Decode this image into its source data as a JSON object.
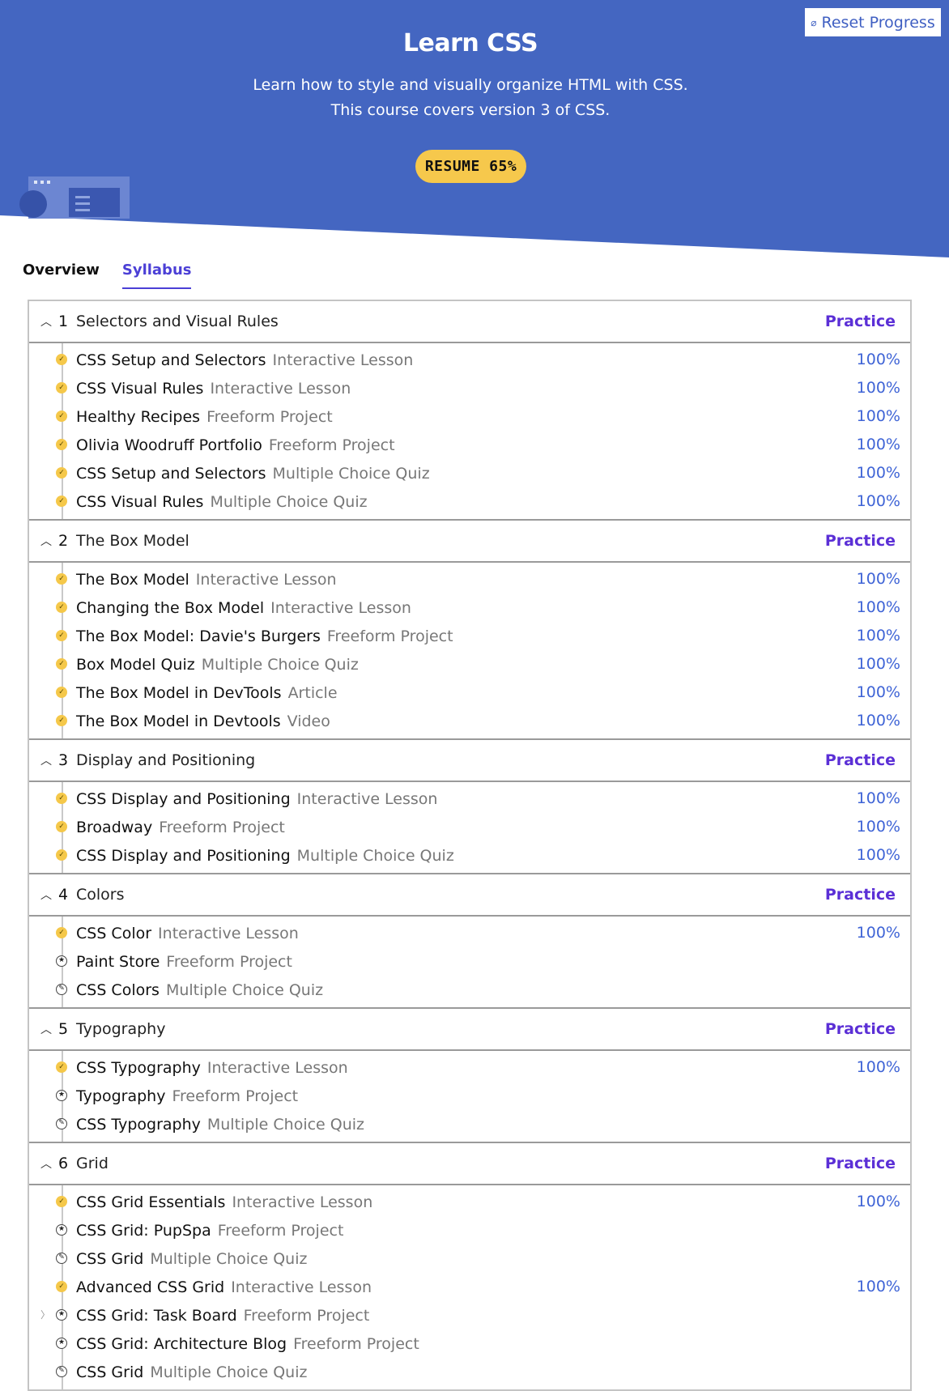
{
  "header": {
    "reset_label": "Reset Progress",
    "reset_icon": "reset-icon",
    "title": "Learn CSS",
    "description": "Learn how to style and visually organize HTML with CSS. This course covers version 3 of CSS.",
    "resume_label": "RESUME 65%",
    "resume_progress_percent": 65
  },
  "colors": {
    "hero_bg": "#4466c1",
    "accent_yellow": "#f6c84c",
    "practice": "#5b2fd6",
    "percent": "#3f64d6",
    "tab_active": "#4b3fd6"
  },
  "tabs": [
    {
      "label": "Overview",
      "active": false
    },
    {
      "label": "Syllabus",
      "active": true
    }
  ],
  "sections": [
    {
      "num": "1",
      "title": "Selectors and Visual Rules",
      "practice": "Practice",
      "items": [
        {
          "name": "CSS Setup and Selectors",
          "type": "Interactive Lesson",
          "percent": "100%",
          "status": "done"
        },
        {
          "name": "CSS Visual Rules",
          "type": "Interactive Lesson",
          "percent": "100%",
          "status": "done"
        },
        {
          "name": "Healthy Recipes",
          "type": "Freeform Project",
          "percent": "100%",
          "status": "done"
        },
        {
          "name": "Olivia Woodruff Portfolio",
          "type": "Freeform Project",
          "percent": "100%",
          "status": "done"
        },
        {
          "name": "CSS Setup and Selectors",
          "type": "Multiple Choice Quiz",
          "percent": "100%",
          "status": "done"
        },
        {
          "name": "CSS Visual Rules",
          "type": "Multiple Choice Quiz",
          "percent": "100%",
          "status": "done"
        }
      ]
    },
    {
      "num": "2",
      "title": "The Box Model",
      "practice": "Practice",
      "items": [
        {
          "name": "The Box Model",
          "type": "Interactive Lesson",
          "percent": "100%",
          "status": "done"
        },
        {
          "name": "Changing the Box Model",
          "type": "Interactive Lesson",
          "percent": "100%",
          "status": "done"
        },
        {
          "name": "The Box Model: Davie's Burgers",
          "type": "Freeform Project",
          "percent": "100%",
          "status": "done"
        },
        {
          "name": "Box Model Quiz",
          "type": "Multiple Choice Quiz",
          "percent": "100%",
          "status": "done"
        },
        {
          "name": "The Box Model in DevTools",
          "type": "Article",
          "percent": "100%",
          "status": "done"
        },
        {
          "name": "The Box Model in Devtools",
          "type": "Video",
          "percent": "100%",
          "status": "done"
        }
      ]
    },
    {
      "num": "3",
      "title": "Display and Positioning",
      "practice": "Practice",
      "items": [
        {
          "name": "CSS Display and Positioning",
          "type": "Interactive Lesson",
          "percent": "100%",
          "status": "done"
        },
        {
          "name": "Broadway",
          "type": "Freeform Project",
          "percent": "100%",
          "status": "done"
        },
        {
          "name": "CSS Display and Positioning",
          "type": "Multiple Choice Quiz",
          "percent": "100%",
          "status": "done"
        }
      ]
    },
    {
      "num": "4",
      "title": "Colors",
      "practice": "Practice",
      "items": [
        {
          "name": "CSS Color",
          "type": "Interactive Lesson",
          "percent": "100%",
          "status": "done"
        },
        {
          "name": "Paint Store",
          "type": "Freeform Project",
          "percent": "",
          "status": "project"
        },
        {
          "name": "CSS Colors",
          "type": "Multiple Choice Quiz",
          "percent": "",
          "status": "quiz"
        }
      ]
    },
    {
      "num": "5",
      "title": "Typography",
      "practice": "Practice",
      "items": [
        {
          "name": "CSS Typography",
          "type": "Interactive Lesson",
          "percent": "100%",
          "status": "done"
        },
        {
          "name": "Typography",
          "type": "Freeform Project",
          "percent": "",
          "status": "project"
        },
        {
          "name": "CSS Typography",
          "type": "Multiple Choice Quiz",
          "percent": "",
          "status": "quiz"
        }
      ]
    },
    {
      "num": "6",
      "title": "Grid",
      "practice": "Practice",
      "items": [
        {
          "name": "CSS Grid Essentials",
          "type": "Interactive Lesson",
          "percent": "100%",
          "status": "done"
        },
        {
          "name": "CSS Grid: PupSpa",
          "type": "Freeform Project",
          "percent": "",
          "status": "project"
        },
        {
          "name": "CSS Grid",
          "type": "Multiple Choice Quiz",
          "percent": "",
          "status": "quiz"
        },
        {
          "name": "Advanced CSS Grid",
          "type": "Interactive Lesson",
          "percent": "100%",
          "status": "done"
        },
        {
          "name": "CSS Grid: Task Board",
          "type": "Freeform Project",
          "percent": "",
          "status": "project",
          "hover_caret": true
        },
        {
          "name": "CSS Grid: Architecture Blog",
          "type": "Freeform Project",
          "percent": "",
          "status": "project"
        },
        {
          "name": "CSS Grid",
          "type": "Multiple Choice Quiz",
          "percent": "",
          "status": "quiz"
        }
      ]
    }
  ]
}
